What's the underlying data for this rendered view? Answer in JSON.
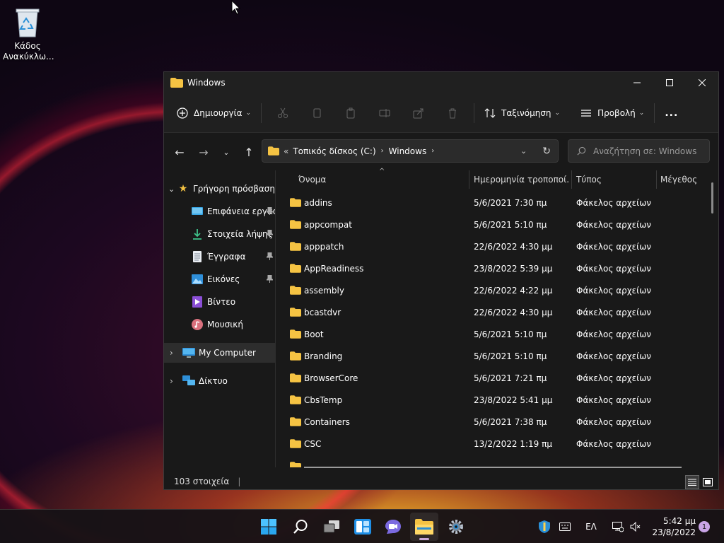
{
  "desktop": {
    "recycle_bin_label": "Κάδος Ανακύκλω..."
  },
  "window": {
    "title": "Windows"
  },
  "commandbar": {
    "new_label": "Δημιουργία",
    "sort_label": "Ταξινόμηση",
    "view_label": "Προβολή",
    "more_label": "..."
  },
  "address": {
    "prefix": "«",
    "crumbs": [
      "Τοπικός δίσκος (C:)",
      "Windows"
    ]
  },
  "search": {
    "placeholder": "Αναζήτηση σε: Windows"
  },
  "sidebar": {
    "quick_access": "Γρήγορη πρόσβαση",
    "items": [
      {
        "label": "Επιφάνεια εργασίας",
        "icon": "desktop-icon",
        "pinned": true
      },
      {
        "label": "Στοιχεία λήψης",
        "icon": "download-icon",
        "pinned": true
      },
      {
        "label": "Έγγραφα",
        "icon": "document-icon",
        "pinned": true
      },
      {
        "label": "Εικόνες",
        "icon": "pictures-icon",
        "pinned": true
      },
      {
        "label": "Βίντεο",
        "icon": "video-icon",
        "pinned": false
      },
      {
        "label": "Μουσική",
        "icon": "music-icon",
        "pinned": false
      }
    ],
    "my_computer": "My Computer",
    "network": "Δίκτυο"
  },
  "columns": {
    "name": "Όνομα",
    "modified": "Ημερομηνία τροποποί...",
    "type": "Τύπος",
    "size": "Μέγεθος"
  },
  "files": [
    {
      "name": "addins",
      "date": "5/6/2021 7:30 πμ",
      "type": "Φάκελος αρχείων"
    },
    {
      "name": "appcompat",
      "date": "5/6/2021 5:10 πμ",
      "type": "Φάκελος αρχείων"
    },
    {
      "name": "apppatch",
      "date": "22/6/2022 4:30 μμ",
      "type": "Φάκελος αρχείων"
    },
    {
      "name": "AppReadiness",
      "date": "23/8/2022 5:39 μμ",
      "type": "Φάκελος αρχείων"
    },
    {
      "name": "assembly",
      "date": "22/6/2022 4:22 μμ",
      "type": "Φάκελος αρχείων"
    },
    {
      "name": "bcastdvr",
      "date": "22/6/2022 4:30 μμ",
      "type": "Φάκελος αρχείων"
    },
    {
      "name": "Boot",
      "date": "5/6/2021 5:10 πμ",
      "type": "Φάκελος αρχείων"
    },
    {
      "name": "Branding",
      "date": "5/6/2021 5:10 πμ",
      "type": "Φάκελος αρχείων"
    },
    {
      "name": "BrowserCore",
      "date": "5/6/2021 7:21 πμ",
      "type": "Φάκελος αρχείων"
    },
    {
      "name": "CbsTemp",
      "date": "23/8/2022 5:41 μμ",
      "type": "Φάκελος αρχείων"
    },
    {
      "name": "Containers",
      "date": "5/6/2021 7:38 πμ",
      "type": "Φάκελος αρχείων"
    },
    {
      "name": "CSC",
      "date": "13/2/2022 1:19 πμ",
      "type": "Φάκελος αρχείων"
    }
  ],
  "status": {
    "count": "103 στοιχεία"
  },
  "tray": {
    "language": "ΕΛ",
    "time": "5:42 μμ",
    "date": "23/8/2022",
    "notifications": "1"
  },
  "colors": {
    "folder": "#f5c343",
    "accent": "#4cc2ff"
  }
}
